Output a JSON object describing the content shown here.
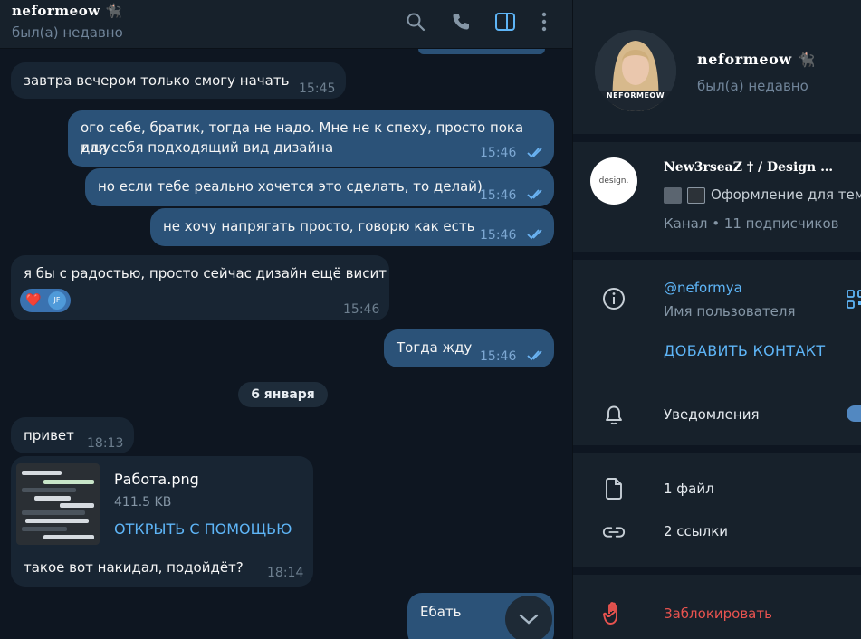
{
  "chat": {
    "name": "neformeow 🐈‍⬛",
    "status": "был(а) недавно",
    "date_divider": "6 января",
    "messages": [
      {
        "text": "завтра вечером только смогу начать",
        "time": "15:45"
      },
      {
        "text_line1": "ого себе, братик, тогда не надо. Мне не к спеху, просто пока ищу",
        "text_line2": "для себя подходящий вид дизайна",
        "time": "15:46"
      },
      {
        "text": "но если тебе реально хочется это сделать, то делай)",
        "time": "15:46"
      },
      {
        "text": "не хочу напрягать просто, говорю как есть",
        "time": "15:46"
      },
      {
        "text": "я бы с радостью, просто сейчас дизайн ещё висит",
        "time": "15:46",
        "reaction": "❤️",
        "reactor": "JF"
      },
      {
        "text": "Тогда жду",
        "time": "15:46"
      },
      {
        "text": "привет",
        "time": "18:13"
      },
      {
        "file_name": "Работа.png",
        "file_size": "411.5 KB",
        "open_with": "ОТКРЫТЬ С ПОМОЩЬЮ",
        "caption": "такое вот накидал, подойдёт?",
        "time": "18:14"
      },
      {
        "text": "Ебать"
      }
    ]
  },
  "header_icons": [
    "search-icon",
    "phone-icon",
    "sidebar-toggle-icon",
    "more-vertical-icon"
  ],
  "panel": {
    "name": "neformeow 🐈‍⬛",
    "status": "был(а) недавно",
    "avatar_label": "NEFORMEOW",
    "channel": {
      "avatar_text": "design.",
      "title": "New3rseaZ † / Design …",
      "description": "Оформление для тем",
      "subscribers": "Канал • 11 подписчиков"
    },
    "username": "@neformya",
    "username_label": "Имя пользователя",
    "add_contact": "ДОБАВИТЬ КОНТАКТ",
    "notifications": "Уведомления",
    "files": "1 файл",
    "links": "2 ссылки",
    "block": "Заблокировать"
  },
  "colors": {
    "accent": "#5eb5f7",
    "outgoing": "#2b5278",
    "incoming": "#182533",
    "danger": "#e8534f"
  }
}
